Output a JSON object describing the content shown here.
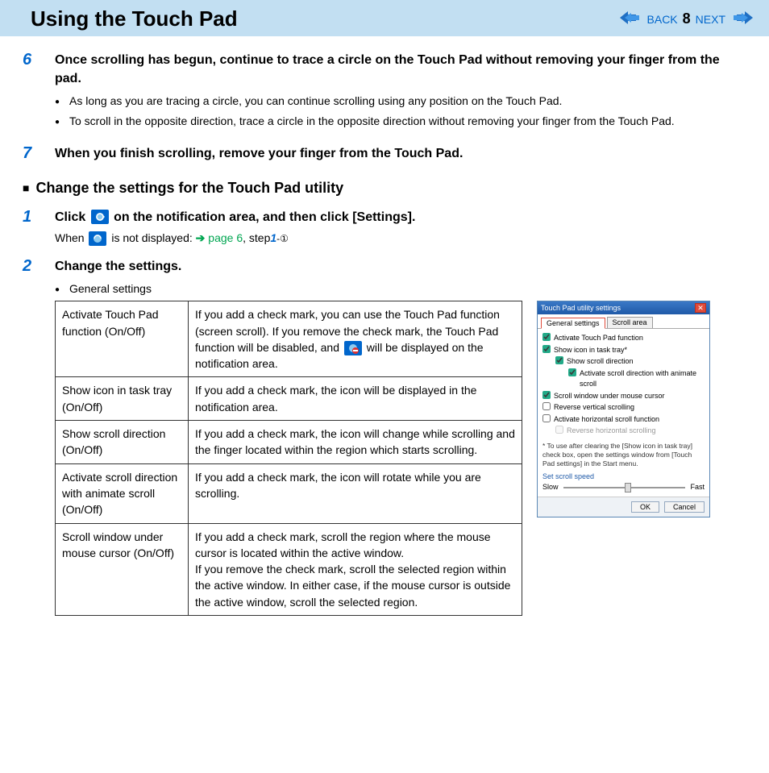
{
  "header": {
    "title": "Using the Touch Pad",
    "back": "BACK",
    "next": "NEXT",
    "page": "8"
  },
  "step6": {
    "num": "6",
    "heading": "Once scrolling has begun, continue to trace a circle on the Touch Pad without removing your finger from the pad.",
    "b1": "As long as you are tracing a circle, you can continue scrolling using any position on the Touch Pad.",
    "b2": "To scroll in the opposite direction, trace a circle in the opposite direction without removing your finger from the Touch Pad."
  },
  "step7": {
    "num": "7",
    "heading": "When you finish scrolling, remove your finger from the Touch Pad."
  },
  "section_title": "Change the settings for the Touch Pad utility",
  "s1": {
    "num": "1",
    "pre": "Click ",
    "post": " on the notification area, and then click [Settings].",
    "note_pre": "When ",
    "note_mid": " is not displayed:",
    "ref_link": " page 6",
    "ref_sep": ", step",
    "ref_step": "1",
    "ref_sub": "-①"
  },
  "s2": {
    "num": "2",
    "heading": "Change the settings.",
    "bullet": "General settings",
    "rows": [
      {
        "k": "Activate Touch Pad function (On/Off)",
        "v_pre": "If you add a check mark, you can use the Touch Pad function (screen scroll). If you remove the check mark, the Touch Pad function will be disabled, and ",
        "v_post": " will be displayed on the notification area."
      },
      {
        "k": "Show icon in task tray (On/Off)",
        "v": "If you add a check mark, the icon will be displayed in the notification area."
      },
      {
        "k": "Show scroll direction (On/Off)",
        "v": "If you add a check mark, the icon will change while scrolling and the finger located within the region which starts scrolling."
      },
      {
        "k": "Activate scroll direction with animate scroll (On/Off)",
        "v": "If you add a check mark, the icon will rotate while you are scrolling."
      },
      {
        "k": "Scroll window under mouse cursor (On/Off)",
        "v": "If you add a check mark, scroll the region where the mouse cursor is located within the active window.\nIf you remove the check mark, scroll the selected region within the active window. In either case, if the mouse cursor is outside the active window, scroll the selected region."
      }
    ]
  },
  "dialog": {
    "title": "Touch Pad utility settings",
    "tab_general": "General settings",
    "tab_scroll": "Scroll area",
    "c1": "Activate Touch Pad function",
    "c2": "Show icon in task tray*",
    "c3": "Show scroll direction",
    "c4": "Activate scroll direction with animate scroll",
    "c5": "Scroll window under mouse cursor",
    "c6": "Reverse vertical scrolling",
    "c7": "Activate horizontal scroll function",
    "c8": "Reverse horizontal scrolling",
    "note": "* To use after clearing the [Show icon in task tray] check box, open the settings window from [Touch Pad settings] in the Start menu.",
    "slider_label": "Set scroll speed",
    "slow": "Slow",
    "fast": "Fast",
    "ok": "OK",
    "cancel": "Cancel"
  }
}
